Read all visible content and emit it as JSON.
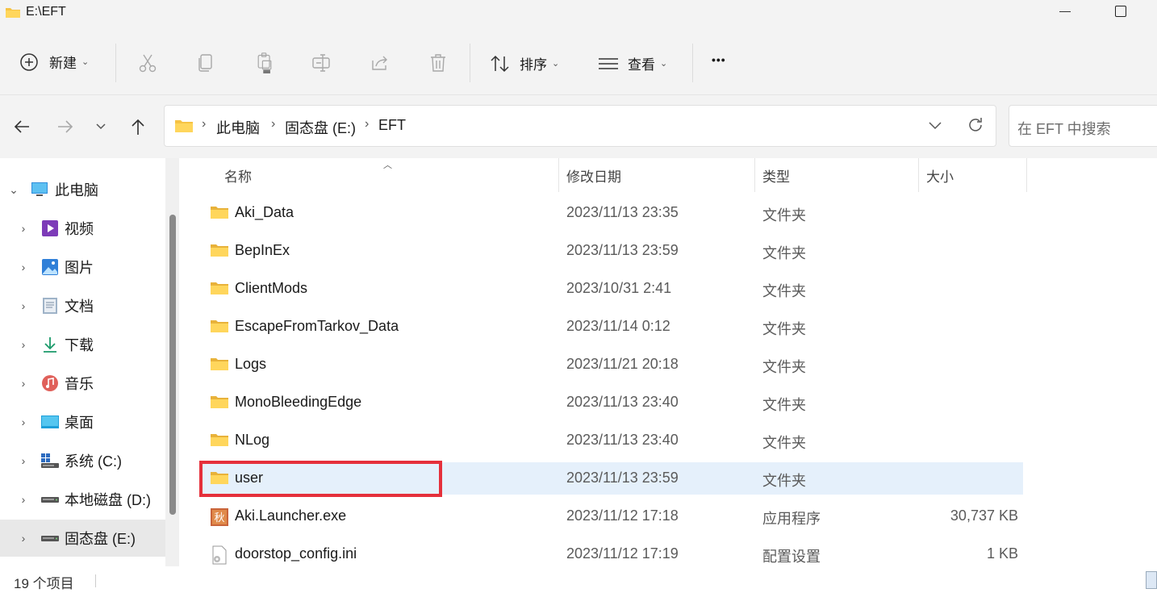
{
  "window": {
    "title": "E:\\EFT"
  },
  "toolbar": {
    "new_label": "新建",
    "sort_label": "排序",
    "view_label": "查看",
    "more_label": "•••"
  },
  "address": {
    "crumbs": [
      "此电脑",
      "固态盘 (E:)",
      "EFT"
    ],
    "search_placeholder": "在 EFT 中搜索"
  },
  "sidebar": {
    "items": [
      {
        "label": "此电脑",
        "icon": "monitor-icon"
      },
      {
        "label": "视频",
        "icon": "video-icon"
      },
      {
        "label": "图片",
        "icon": "picture-icon"
      },
      {
        "label": "文档",
        "icon": "document-icon"
      },
      {
        "label": "下载",
        "icon": "download-icon"
      },
      {
        "label": "音乐",
        "icon": "music-icon"
      },
      {
        "label": "桌面",
        "icon": "desktop-icon"
      },
      {
        "label": "系统 (C:)",
        "icon": "windows-drive-icon"
      },
      {
        "label": "本地磁盘 (D:)",
        "icon": "drive-icon"
      },
      {
        "label": "固态盘 (E:)",
        "icon": "drive-icon"
      }
    ]
  },
  "columns": {
    "name": "名称",
    "date": "修改日期",
    "type": "类型",
    "size": "大小"
  },
  "files": [
    {
      "name": "Aki_Data",
      "date": "2023/11/13 23:35",
      "type": "文件夹",
      "size": "",
      "icon": "folder-icon"
    },
    {
      "name": "BepInEx",
      "date": "2023/11/13 23:59",
      "type": "文件夹",
      "size": "",
      "icon": "folder-icon"
    },
    {
      "name": "ClientMods",
      "date": "2023/10/31 2:41",
      "type": "文件夹",
      "size": "",
      "icon": "folder-icon"
    },
    {
      "name": "EscapeFromTarkov_Data",
      "date": "2023/11/14 0:12",
      "type": "文件夹",
      "size": "",
      "icon": "folder-icon"
    },
    {
      "name": "Logs",
      "date": "2023/11/21 20:18",
      "type": "文件夹",
      "size": "",
      "icon": "folder-icon"
    },
    {
      "name": "MonoBleedingEdge",
      "date": "2023/11/13 23:40",
      "type": "文件夹",
      "size": "",
      "icon": "folder-icon"
    },
    {
      "name": "NLog",
      "date": "2023/11/13 23:40",
      "type": "文件夹",
      "size": "",
      "icon": "folder-icon"
    },
    {
      "name": "user",
      "date": "2023/11/13 23:59",
      "type": "文件夹",
      "size": "",
      "icon": "folder-icon"
    },
    {
      "name": "Aki.Launcher.exe",
      "date": "2023/11/12 17:18",
      "type": "应用程序",
      "size": "30,737 KB",
      "icon": "app-icon"
    },
    {
      "name": "doorstop_config.ini",
      "date": "2023/11/12 17:19",
      "type": "配置设置",
      "size": "1 KB",
      "icon": "config-file-icon"
    }
  ],
  "status": {
    "item_count": "19 个项目"
  },
  "colors": {
    "selection": "#e5f0fb",
    "highlight": "#e5303b",
    "folder": "#f6c344"
  }
}
